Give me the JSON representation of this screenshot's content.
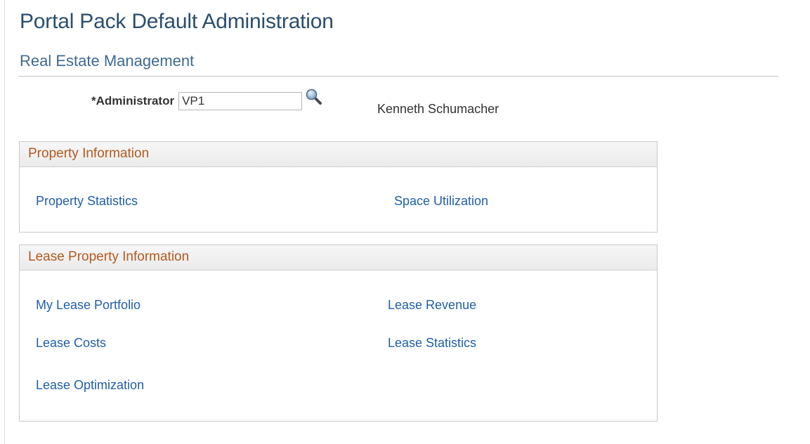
{
  "page": {
    "title": "Portal Pack Default Administration",
    "subtitle": "Real Estate Management"
  },
  "admin": {
    "label": "*Administrator",
    "value": "VP1",
    "name": "Kenneth Schumacher"
  },
  "property_info": {
    "header": "Property Information",
    "links": [
      "Property Statistics",
      "Space Utilization"
    ]
  },
  "lease_info": {
    "header": "Lease Property Information",
    "links": [
      "My Lease Portfolio",
      "Lease Revenue",
      "Lease Costs",
      "Lease Statistics",
      "Lease Optimization"
    ]
  },
  "colors": {
    "title": "#2a4e6e",
    "subtitle": "#3e6a92",
    "group_header": "#b35a1f",
    "link": "#1f5fa8"
  },
  "icons": {
    "lookup": "magnifier-icon"
  }
}
